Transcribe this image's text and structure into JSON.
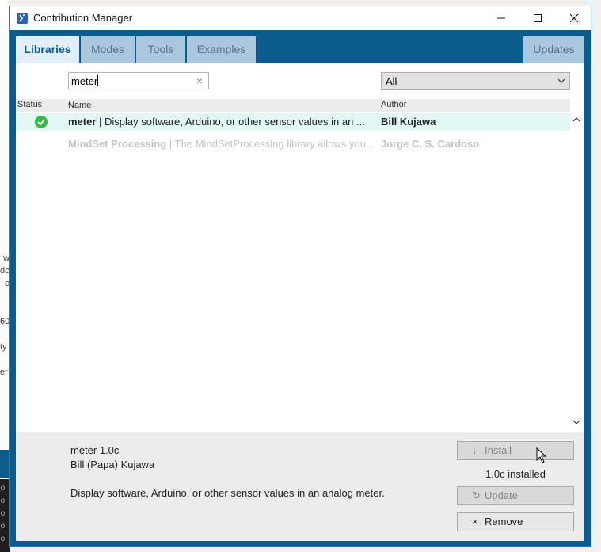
{
  "background_app": {
    "fragments": [
      "w",
      "dc",
      "c",
      "60",
      "ty",
      "er"
    ],
    "console_lines": [
      "Po",
      "Po",
      "Po",
      "Po",
      "Po"
    ]
  },
  "window": {
    "title": "Contribution Manager",
    "controls": {
      "minimize": "minimize",
      "maximize": "maximize",
      "close": "close"
    }
  },
  "tabs": [
    {
      "label": "Libraries",
      "active": true
    },
    {
      "label": "Modes",
      "active": false
    },
    {
      "label": "Tools",
      "active": false
    },
    {
      "label": "Examples",
      "active": false
    }
  ],
  "updates_tab": {
    "label": "Updates"
  },
  "search": {
    "value": "meter",
    "clear_icon": "×"
  },
  "filter": {
    "selected": "All"
  },
  "table": {
    "headers": {
      "status": "Status",
      "name": "Name",
      "name_sort": "^",
      "author": "Author"
    },
    "rows": [
      {
        "status": "installed",
        "name": "meter",
        "separator": " | ",
        "description": "Display software, Arduino, or other sensor values in an ...",
        "author": "Bill  Kujawa",
        "selected": true
      },
      {
        "status": "",
        "name": "MindSet Processing",
        "separator": " | ",
        "description": "The MindSetProcessing library allows you...",
        "author": "Jorge C. S. Cardoso",
        "selected": false
      }
    ]
  },
  "details": {
    "title": "meter 1.0c",
    "author": "Bill (Papa) Kujawa",
    "description": "Display software, Arduino, or other sensor values in an analog meter.",
    "install_label": "Install",
    "installed_text": "1.0c installed",
    "update_label": "Update",
    "remove_label": "Remove"
  },
  "colors": {
    "accent": "#0b5c8d",
    "tab_active_bg": "#e2eff8",
    "tab_inactive_bg": "#a9c7dd",
    "selected_row": "#e2f8f7",
    "installed_check": "#3cb54a"
  }
}
